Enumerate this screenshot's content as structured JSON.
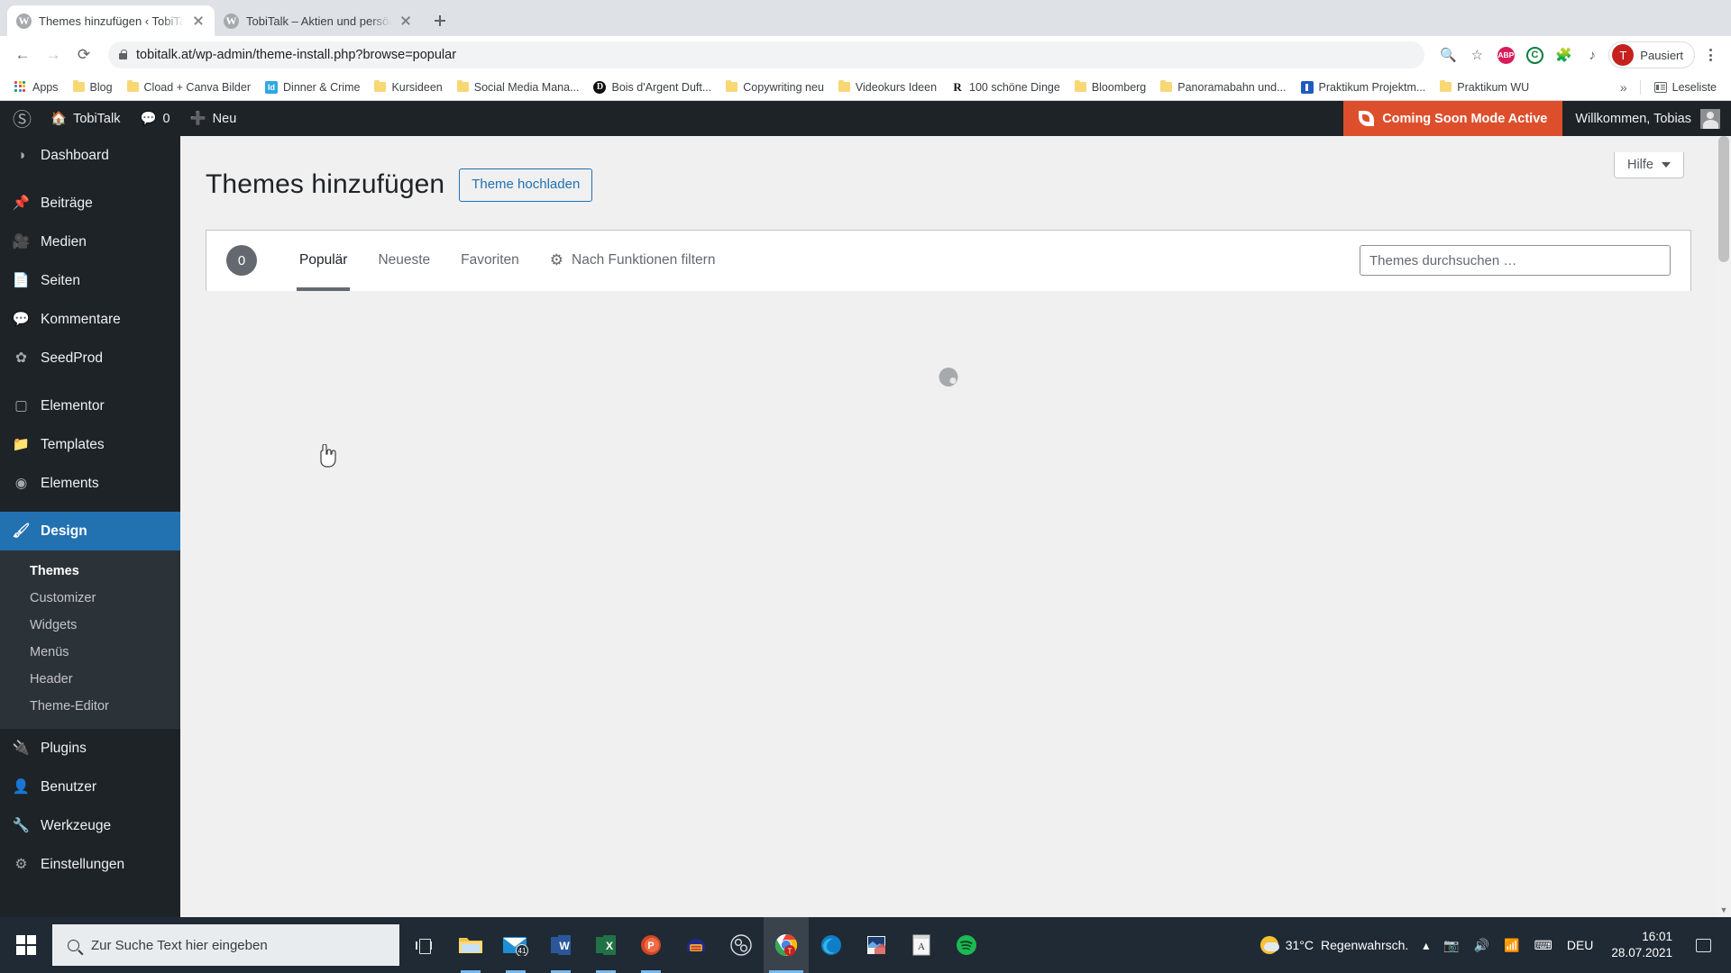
{
  "browser": {
    "tabs": [
      {
        "title": "Themes hinzufügen ‹ TobiTalk —",
        "favicon": "wordpress-icon",
        "active": true
      },
      {
        "title": "TobiTalk – Aktien und persönliche",
        "favicon": "wordpress-icon",
        "active": false
      }
    ],
    "new_tab_label": "+",
    "nav": {
      "back": "←",
      "forward": "→",
      "reload": "⟳"
    },
    "url": "tobitalk.at/wp-admin/theme-install.php?browse=popular",
    "toolbar_icons": [
      "zoom-icon",
      "bookmark-star-icon",
      "adblock-plus-extension-icon",
      "ghostery-extension-icon",
      "extensions-puzzle-icon",
      "media-list-icon"
    ],
    "profile": {
      "label": "Pausiert",
      "initial": "T"
    },
    "bookmarks": [
      {
        "label": "Apps",
        "icon": "apps-grid-icon"
      },
      {
        "label": "Blog",
        "icon": "folder-icon"
      },
      {
        "label": "Cload + Canva Bilder",
        "icon": "folder-icon"
      },
      {
        "label": "Dinner & Crime",
        "icon": "indesign-icon"
      },
      {
        "label": "Kursideen",
        "icon": "folder-icon"
      },
      {
        "label": "Social Media Mana...",
        "icon": "folder-icon"
      },
      {
        "label": "Bois d'Argent Duft...",
        "icon": "dior-icon"
      },
      {
        "label": "Copywriting neu",
        "icon": "folder-icon"
      },
      {
        "label": "Videokurs Ideen",
        "icon": "folder-icon"
      },
      {
        "label": "100 schöne Dinge",
        "icon": "serif-r-icon"
      },
      {
        "label": "Bloomberg",
        "icon": "folder-icon"
      },
      {
        "label": "Panoramabahn und...",
        "icon": "folder-icon"
      },
      {
        "label": "Praktikum Projektm...",
        "icon": "blue-doc-icon"
      },
      {
        "label": "Praktikum WU",
        "icon": "folder-icon"
      }
    ],
    "bookmarks_overflow": "»",
    "reading_list": "Leseliste"
  },
  "adminbar": {
    "logo": "wordpress-logo-icon",
    "site_name": "TobiTalk",
    "comments_count": "0",
    "new_label": "Neu",
    "coming_soon": "Coming Soon Mode Active",
    "welcome": "Willkommen, Tobias"
  },
  "sidebar": {
    "items": [
      {
        "label": "Dashboard",
        "icon": "dashboard-icon"
      },
      {
        "label": "Beiträge",
        "icon": "pin-icon"
      },
      {
        "label": "Medien",
        "icon": "media-icon"
      },
      {
        "label": "Seiten",
        "icon": "pages-icon"
      },
      {
        "label": "Kommentare",
        "icon": "comment-icon"
      },
      {
        "label": "SeedProd",
        "icon": "seedprod-leaf-icon"
      },
      {
        "label": "Elementor",
        "icon": "elementor-icon"
      },
      {
        "label": "Templates",
        "icon": "folder-open-icon"
      },
      {
        "label": "Elements",
        "icon": "elements-icon"
      },
      {
        "label": "Design",
        "icon": "paintbrush-icon",
        "current": true
      },
      {
        "label": "Plugins",
        "icon": "plug-icon"
      },
      {
        "label": "Benutzer",
        "icon": "user-icon"
      },
      {
        "label": "Werkzeuge",
        "icon": "wrench-icon"
      },
      {
        "label": "Einstellungen",
        "icon": "settings-sliders-icon"
      }
    ],
    "submenu": [
      {
        "label": "Themes",
        "active": true
      },
      {
        "label": "Customizer",
        "active": false
      },
      {
        "label": "Widgets",
        "active": false
      },
      {
        "label": "Menüs",
        "active": false
      },
      {
        "label": "Header",
        "active": false
      },
      {
        "label": "Theme-Editor",
        "active": false
      }
    ]
  },
  "main": {
    "help_label": "Hilfe",
    "title": "Themes hinzufügen",
    "upload_button": "Theme hochladen",
    "theme_count": "0",
    "tabs": [
      {
        "label": "Populär",
        "selected": true
      },
      {
        "label": "Neueste",
        "selected": false
      },
      {
        "label": "Favoriten",
        "selected": false
      }
    ],
    "feature_filter": "Nach Funktionen filtern",
    "feature_filter_icon": "gear-icon",
    "search_value": "",
    "search_placeholder": "Themes durchsuchen …",
    "loading_icon": "spinner-icon"
  },
  "taskbar": {
    "start_icon": "windows-start-icon",
    "search_placeholder": "Zur Suche Text hier eingeben",
    "search_icon": "search-icon",
    "task_view_icon": "task-view-icon",
    "apps": [
      {
        "name": "file-explorer-icon"
      },
      {
        "name": "mail-icon",
        "badge": "41"
      },
      {
        "name": "word-icon"
      },
      {
        "name": "excel-icon"
      },
      {
        "name": "powerpoint-icon"
      },
      {
        "name": "audacity-icon"
      },
      {
        "name": "obs-icon"
      },
      {
        "name": "chrome-icon",
        "active": true
      },
      {
        "name": "edge-icon"
      },
      {
        "name": "photo-app-icon"
      },
      {
        "name": "notepad-icon"
      },
      {
        "name": "spotify-icon"
      }
    ],
    "weather_temp": "31°C",
    "weather_text": "Regenwahrsch.",
    "tray_icons": [
      "chevron-up-icon",
      "camera-icon",
      "volume-icon",
      "wifi-icon",
      "keyboard-icon"
    ],
    "language": "DEU",
    "time": "16:01",
    "date": "28.07.2021",
    "notification_icon": "notification-icon"
  },
  "colors": {
    "wp_dark": "#1d2327",
    "wp_blue": "#2271b1",
    "coming_soon_orange": "#dd4f2c",
    "taskbar": "#1f2a34"
  }
}
